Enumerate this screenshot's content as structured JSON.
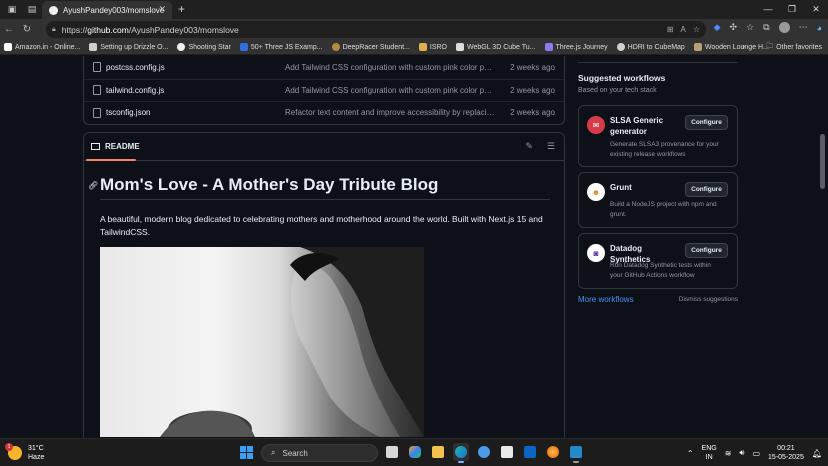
{
  "browser": {
    "tab_title": "AyushPandey003/momslove",
    "url_prefix": "https://",
    "url_host": "github.com",
    "url_path": "/AyushPandey003/momslove"
  },
  "bookmarks": [
    {
      "label": "Amazon.in - Online...",
      "color": "#ffffff"
    },
    {
      "label": "Setting up Drizzle O...",
      "color": "#cfcfcf"
    },
    {
      "label": "Shooting Star",
      "color": "#f0f0f0"
    },
    {
      "label": "50+ Three JS Examp...",
      "color": "#2f6fde"
    },
    {
      "label": "DeepRacer Student...",
      "color": "#b58a3a"
    },
    {
      "label": "ISRO",
      "color": "#e0b04a"
    },
    {
      "label": "WebGL 3D Cube Tu...",
      "color": "#dddddd"
    },
    {
      "label": "Three.js Journey",
      "color": "#8a7cf0"
    },
    {
      "label": "HDRI to CubeMap",
      "color": "#d0d0d0"
    },
    {
      "label": "Wooden Lounge H...",
      "color": "#b5a07a"
    }
  ],
  "other_favorites": "Other favorites",
  "files": [
    {
      "name": "postcss.config.js",
      "message": "Add Tailwind CSS configuration with custom pink color palette",
      "date": "2 weeks ago"
    },
    {
      "name": "tailwind.config.js",
      "message": "Add Tailwind CSS configuration with custom pink color palette",
      "date": "2 weeks ago"
    },
    {
      "name": "tsconfig.json",
      "message": "Refactor text content and improve accessibility by replacing ...",
      "date": "2 weeks ago"
    }
  ],
  "readme": {
    "tab_label": "README",
    "title": "Mom's Love - A Mother's Day Tribute Blog",
    "description": "A beautiful, modern blog dedicated to celebrating mothers and motherhood around the world. Built with Next.js 15 and TailwindCSS."
  },
  "sidebar": {
    "title": "Suggested workflows",
    "subtitle": "Based on your tech stack",
    "workflows": [
      {
        "name": "SLSA Generic generator",
        "desc": "Generate SLSA3 provenance for your existing release workflows",
        "button": "Configure",
        "icon": "slsa-icon",
        "icon_color": "#d73a49"
      },
      {
        "name": "Grunt",
        "desc": "Build a NodeJS project with npm and grunt.",
        "button": "Configure",
        "icon": "grunt-icon",
        "icon_color": "#e48632"
      },
      {
        "name": "Datadog Synthetics",
        "desc": "Run Datadog Synthetic tests within your GitHub Actions workflow",
        "button": "Configure",
        "icon": "datadog-icon",
        "icon_color": "#632ca6"
      }
    ],
    "more_link": "More workflows",
    "dismiss_link": "Dismiss suggestions"
  },
  "taskbar": {
    "temperature": "31°C",
    "weather": "Haze",
    "weather_badge": "1",
    "search_placeholder": "Search",
    "lang_top": "ENG",
    "lang_bottom": "IN",
    "time": "00:21",
    "date": "15-05-2025"
  }
}
